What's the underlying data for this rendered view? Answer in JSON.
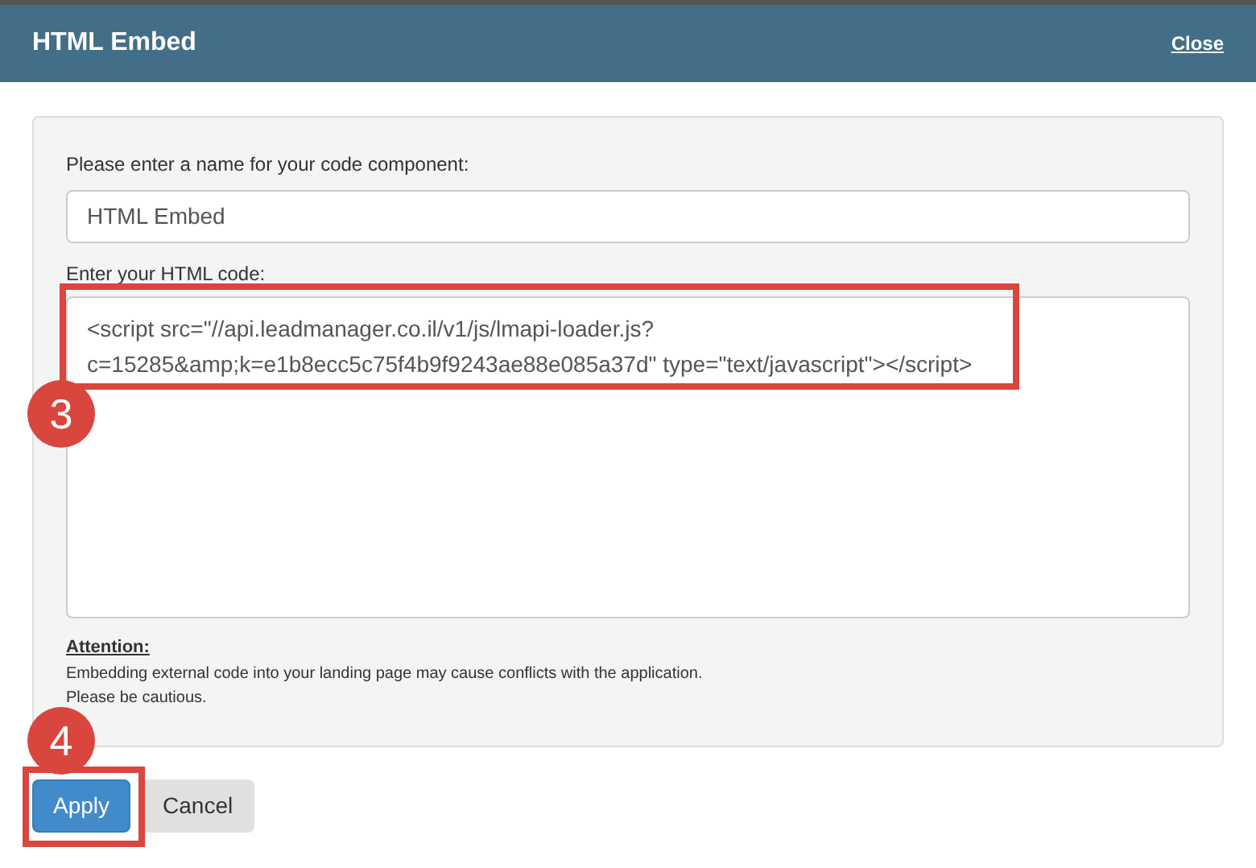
{
  "dialog": {
    "title": "HTML Embed",
    "close_link": "Close"
  },
  "name_field": {
    "label": "Please enter a name for your code component:",
    "value": "HTML Embed"
  },
  "code_field": {
    "label": "Enter your HTML code:",
    "value_lines": [
      "<script src=\"//api.leadmanager.co.il/v1/js/lmapi-loader.js?",
      "c=15285&amp;k=e1b8ecc5c75f4b9f9243ae88e085a37d\" type=\"text/javascript\"></script>"
    ]
  },
  "attention": {
    "heading": "Attention:",
    "lines": [
      "Embedding external code into your landing page may cause conflicts with the application.",
      "Please be cautious."
    ]
  },
  "buttons": [
    {
      "label": "Apply",
      "kind": "primary"
    },
    {
      "label": "Cancel",
      "kind": "secondary"
    }
  ],
  "callouts": [
    {
      "number": "3"
    },
    {
      "number": "4"
    }
  ]
}
